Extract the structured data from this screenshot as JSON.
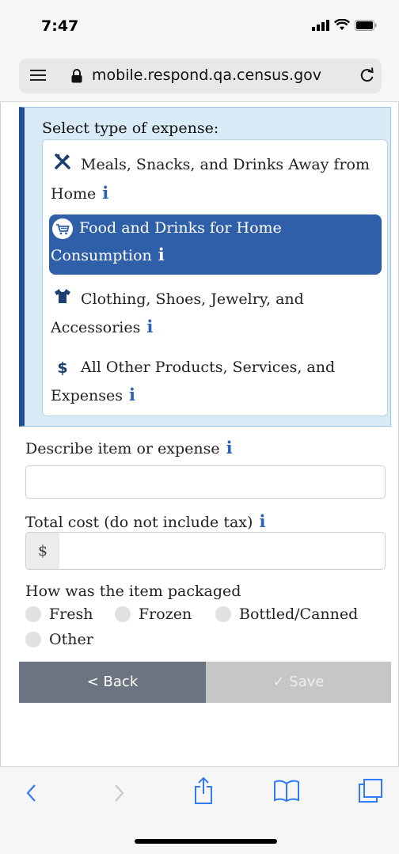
{
  "status_bar": {
    "time": "7:47"
  },
  "browser": {
    "url": "mobile.respond.qa.census.gov"
  },
  "expense_panel": {
    "label": "Select type of expense:",
    "options": [
      {
        "line1": "Meals, Snacks, and Drinks Away from",
        "line2": "Home",
        "icon": "utensils-icon",
        "selected": false
      },
      {
        "line1": "Food and Drinks for Home",
        "line2": "Consumption",
        "icon": "shopping-cart-icon",
        "selected": true
      },
      {
        "line1": "Clothing, Shoes, Jewelry, and",
        "line2": "Accessories",
        "icon": "shirt-icon",
        "selected": false
      },
      {
        "line1": "All Other Products, Services, and",
        "line2": "Expenses",
        "icon": "dollar-icon",
        "selected": false
      }
    ],
    "info_glyph": "i"
  },
  "form": {
    "describe_label": "Describe item or expense",
    "describe_value": "",
    "cost_label": "Total cost (do not include tax)",
    "currency_symbol": "$",
    "cost_value": "",
    "packaging_label": "How was the item packaged",
    "packaging_options": [
      "Fresh",
      "Frozen",
      "Bottled/Canned",
      "Other"
    ]
  },
  "buttons": {
    "back": "< Back",
    "save": "✓ Save"
  },
  "colors": {
    "selected_bg": "#2f5fa8",
    "panel_border": "#1f4f9a",
    "info_blue": "#2a62b5",
    "back_bg": "#6b7480",
    "save_bg": "#c6c6c6",
    "ios_blue": "#2f7bf6"
  }
}
